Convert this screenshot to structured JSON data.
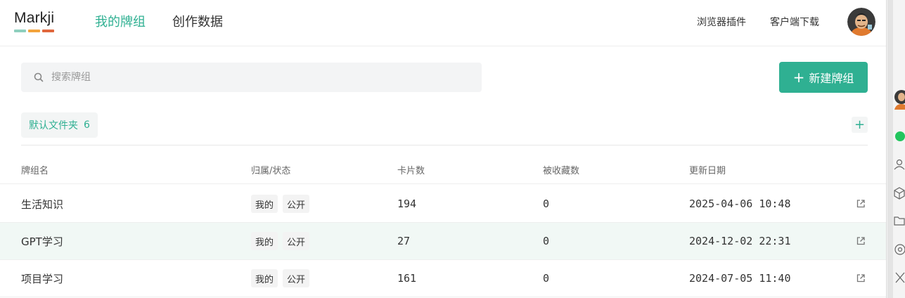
{
  "header": {
    "logo": "Markji",
    "logo_colors": [
      "#8ecfbe",
      "#f3a43c",
      "#e0673c"
    ],
    "tabs": [
      {
        "label": "我的牌组",
        "active": true
      },
      {
        "label": "创作数据",
        "active": false
      }
    ],
    "links": {
      "browser_plugin": "浏览器插件",
      "client_download": "客户端下载"
    }
  },
  "search": {
    "placeholder": "搜索牌组"
  },
  "new_deck_button": {
    "label": "新建牌组"
  },
  "folder": {
    "name": "默认文件夹",
    "count": "6"
  },
  "table": {
    "columns": {
      "name": "牌组名",
      "status": "归属/状态",
      "cards": "卡片数",
      "favorites": "被收藏数",
      "updated": "更新日期"
    },
    "rows": [
      {
        "name": "生活知识",
        "owner": "我的",
        "visibility": "公开",
        "cards": "194",
        "favorites": "0",
        "updated": "2025-04-06 10:48"
      },
      {
        "name": "GPT学习",
        "owner": "我的",
        "visibility": "公开",
        "cards": "27",
        "favorites": "0",
        "updated": "2024-12-02 22:31"
      },
      {
        "name": "项目学习",
        "owner": "我的",
        "visibility": "公开",
        "cards": "161",
        "favorites": "0",
        "updated": "2024-07-05 11:40"
      }
    ]
  },
  "colors": {
    "accent": "#2fb092",
    "highlight_row": "#f1f8f5"
  }
}
